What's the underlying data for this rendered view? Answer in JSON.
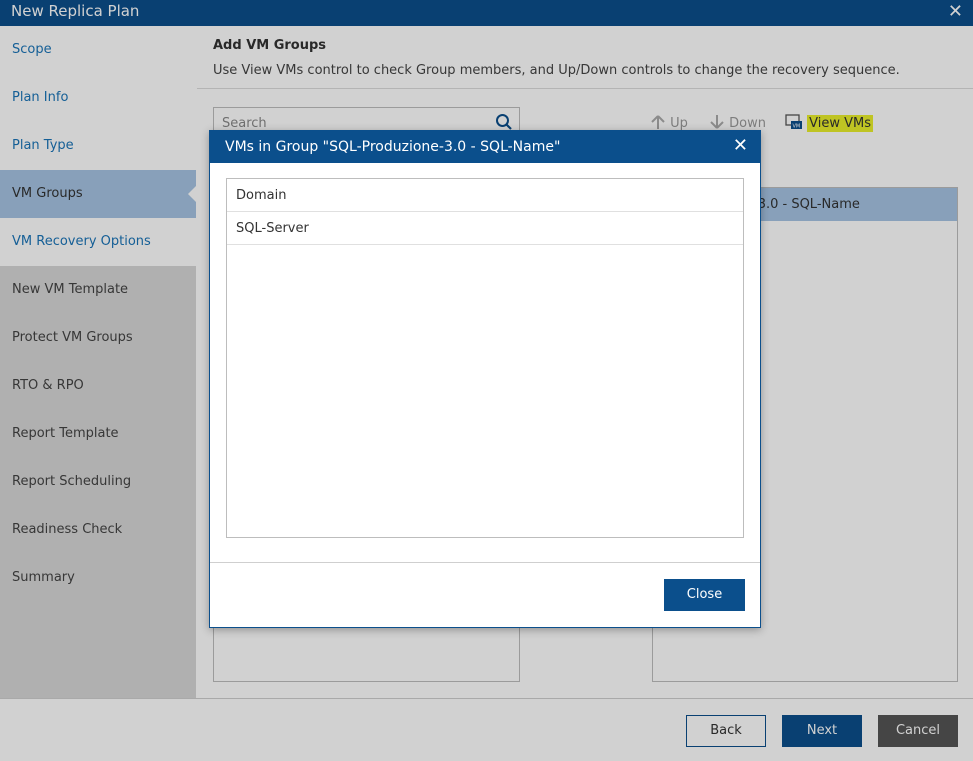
{
  "window": {
    "title": "New Replica Plan"
  },
  "sidebar": {
    "items": [
      {
        "label": "Scope"
      },
      {
        "label": "Plan Info"
      },
      {
        "label": "Plan Type"
      },
      {
        "label": "VM Groups"
      },
      {
        "label": "VM Recovery Options"
      },
      {
        "label": "New VM Template"
      },
      {
        "label": "Protect VM Groups"
      },
      {
        "label": "RTO & RPO"
      },
      {
        "label": "Report Template"
      },
      {
        "label": "Report Scheduling"
      },
      {
        "label": "Readiness Check"
      },
      {
        "label": "Summary"
      }
    ]
  },
  "content": {
    "heading": "Add VM Groups",
    "description": "Use View VMs control to check Group members, and Up/Down controls to change the recovery sequence.",
    "search": {
      "placeholder": "Search"
    },
    "toolbar": {
      "up": "Up",
      "down": "Down",
      "view_vms": "View VMs"
    },
    "selected_group_visible_text": "-3.0 - SQL-Name"
  },
  "footer": {
    "back": "Back",
    "next": "Next",
    "cancel": "Cancel"
  },
  "modal": {
    "title": "VMs in Group \"SQL-Produzione-3.0 - SQL-Name\"",
    "vms": [
      "Domain",
      "SQL-Server"
    ],
    "close_label": "Close"
  },
  "colors": {
    "primary": "#0b4f8c",
    "selected": "#a6c4e3",
    "highlight": "#e9ef2b",
    "link": "#1a74b8"
  }
}
